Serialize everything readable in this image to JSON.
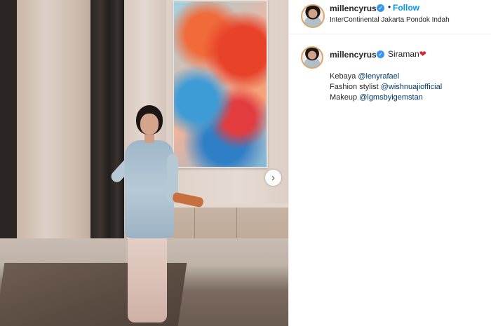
{
  "post": {
    "username": "millencyrus",
    "follow_label": "Follow",
    "separator": "•",
    "location": "InterContinental Jakarta Pondok Indah",
    "verified_icon": "verified-badge-icon",
    "colors": {
      "follow": "#0095f6",
      "verified": "#3897f0",
      "heart": "#d8253a",
      "mention": "#00376b"
    }
  },
  "caption": {
    "username": "millencyrus",
    "text": "Siraman",
    "heart_icon": "heart-icon",
    "lines": [
      {
        "label": "Kebaya ",
        "mention": "@lenyrafael"
      },
      {
        "label": "Fashion stylist ",
        "mention": "@wishnuajiofficial"
      },
      {
        "label": "Makeup ",
        "mention": "@lgmsbyigemstan"
      }
    ]
  },
  "carousel": {
    "next_icon": "chevron-right-icon"
  }
}
